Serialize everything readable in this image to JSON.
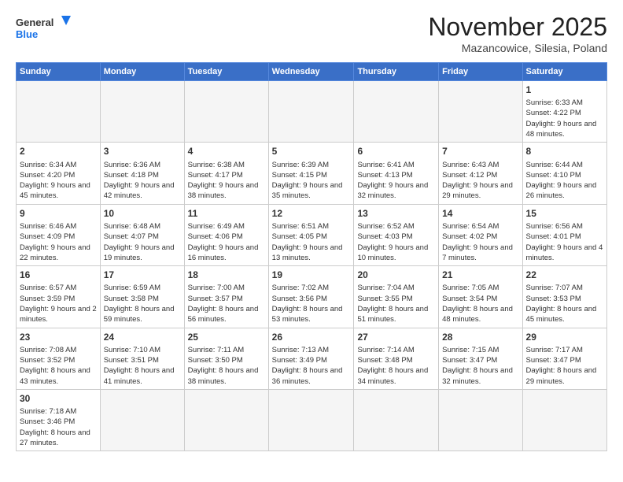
{
  "header": {
    "logo_general": "General",
    "logo_blue": "Blue",
    "month_title": "November 2025",
    "location": "Mazancowice, Silesia, Poland"
  },
  "weekdays": [
    "Sunday",
    "Monday",
    "Tuesday",
    "Wednesday",
    "Thursday",
    "Friday",
    "Saturday"
  ],
  "weeks": [
    [
      {
        "day": "",
        "info": ""
      },
      {
        "day": "",
        "info": ""
      },
      {
        "day": "",
        "info": ""
      },
      {
        "day": "",
        "info": ""
      },
      {
        "day": "",
        "info": ""
      },
      {
        "day": "",
        "info": ""
      },
      {
        "day": "1",
        "info": "Sunrise: 6:33 AM\nSunset: 4:22 PM\nDaylight: 9 hours and 48 minutes."
      }
    ],
    [
      {
        "day": "2",
        "info": "Sunrise: 6:34 AM\nSunset: 4:20 PM\nDaylight: 9 hours and 45 minutes."
      },
      {
        "day": "3",
        "info": "Sunrise: 6:36 AM\nSunset: 4:18 PM\nDaylight: 9 hours and 42 minutes."
      },
      {
        "day": "4",
        "info": "Sunrise: 6:38 AM\nSunset: 4:17 PM\nDaylight: 9 hours and 38 minutes."
      },
      {
        "day": "5",
        "info": "Sunrise: 6:39 AM\nSunset: 4:15 PM\nDaylight: 9 hours and 35 minutes."
      },
      {
        "day": "6",
        "info": "Sunrise: 6:41 AM\nSunset: 4:13 PM\nDaylight: 9 hours and 32 minutes."
      },
      {
        "day": "7",
        "info": "Sunrise: 6:43 AM\nSunset: 4:12 PM\nDaylight: 9 hours and 29 minutes."
      },
      {
        "day": "8",
        "info": "Sunrise: 6:44 AM\nSunset: 4:10 PM\nDaylight: 9 hours and 26 minutes."
      }
    ],
    [
      {
        "day": "9",
        "info": "Sunrise: 6:46 AM\nSunset: 4:09 PM\nDaylight: 9 hours and 22 minutes."
      },
      {
        "day": "10",
        "info": "Sunrise: 6:48 AM\nSunset: 4:07 PM\nDaylight: 9 hours and 19 minutes."
      },
      {
        "day": "11",
        "info": "Sunrise: 6:49 AM\nSunset: 4:06 PM\nDaylight: 9 hours and 16 minutes."
      },
      {
        "day": "12",
        "info": "Sunrise: 6:51 AM\nSunset: 4:05 PM\nDaylight: 9 hours and 13 minutes."
      },
      {
        "day": "13",
        "info": "Sunrise: 6:52 AM\nSunset: 4:03 PM\nDaylight: 9 hours and 10 minutes."
      },
      {
        "day": "14",
        "info": "Sunrise: 6:54 AM\nSunset: 4:02 PM\nDaylight: 9 hours and 7 minutes."
      },
      {
        "day": "15",
        "info": "Sunrise: 6:56 AM\nSunset: 4:01 PM\nDaylight: 9 hours and 4 minutes."
      }
    ],
    [
      {
        "day": "16",
        "info": "Sunrise: 6:57 AM\nSunset: 3:59 PM\nDaylight: 9 hours and 2 minutes."
      },
      {
        "day": "17",
        "info": "Sunrise: 6:59 AM\nSunset: 3:58 PM\nDaylight: 8 hours and 59 minutes."
      },
      {
        "day": "18",
        "info": "Sunrise: 7:00 AM\nSunset: 3:57 PM\nDaylight: 8 hours and 56 minutes."
      },
      {
        "day": "19",
        "info": "Sunrise: 7:02 AM\nSunset: 3:56 PM\nDaylight: 8 hours and 53 minutes."
      },
      {
        "day": "20",
        "info": "Sunrise: 7:04 AM\nSunset: 3:55 PM\nDaylight: 8 hours and 51 minutes."
      },
      {
        "day": "21",
        "info": "Sunrise: 7:05 AM\nSunset: 3:54 PM\nDaylight: 8 hours and 48 minutes."
      },
      {
        "day": "22",
        "info": "Sunrise: 7:07 AM\nSunset: 3:53 PM\nDaylight: 8 hours and 45 minutes."
      }
    ],
    [
      {
        "day": "23",
        "info": "Sunrise: 7:08 AM\nSunset: 3:52 PM\nDaylight: 8 hours and 43 minutes."
      },
      {
        "day": "24",
        "info": "Sunrise: 7:10 AM\nSunset: 3:51 PM\nDaylight: 8 hours and 41 minutes."
      },
      {
        "day": "25",
        "info": "Sunrise: 7:11 AM\nSunset: 3:50 PM\nDaylight: 8 hours and 38 minutes."
      },
      {
        "day": "26",
        "info": "Sunrise: 7:13 AM\nSunset: 3:49 PM\nDaylight: 8 hours and 36 minutes."
      },
      {
        "day": "27",
        "info": "Sunrise: 7:14 AM\nSunset: 3:48 PM\nDaylight: 8 hours and 34 minutes."
      },
      {
        "day": "28",
        "info": "Sunrise: 7:15 AM\nSunset: 3:47 PM\nDaylight: 8 hours and 32 minutes."
      },
      {
        "day": "29",
        "info": "Sunrise: 7:17 AM\nSunset: 3:47 PM\nDaylight: 8 hours and 29 minutes."
      }
    ],
    [
      {
        "day": "30",
        "info": "Sunrise: 7:18 AM\nSunset: 3:46 PM\nDaylight: 8 hours and 27 minutes."
      },
      {
        "day": "",
        "info": ""
      },
      {
        "day": "",
        "info": ""
      },
      {
        "day": "",
        "info": ""
      },
      {
        "day": "",
        "info": ""
      },
      {
        "day": "",
        "info": ""
      },
      {
        "day": "",
        "info": ""
      }
    ]
  ]
}
